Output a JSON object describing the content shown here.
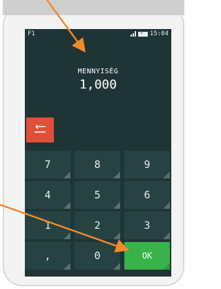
{
  "status_bar": {
    "left_label": "F1",
    "time": "15:04"
  },
  "field": {
    "title": "MENNYISÉG",
    "value": "1,000"
  },
  "keypad": {
    "keys": [
      "7",
      "8",
      "9",
      "4",
      "5",
      "6",
      "1",
      "2",
      "3",
      ",",
      "0"
    ],
    "ok_label": "OK"
  },
  "colors": {
    "screen_bg": "#1f3535",
    "key_bg": "#274242",
    "back_button": "#e05038",
    "ok_button": "#37b34a",
    "annotation_arrow": "#f08a2a"
  }
}
